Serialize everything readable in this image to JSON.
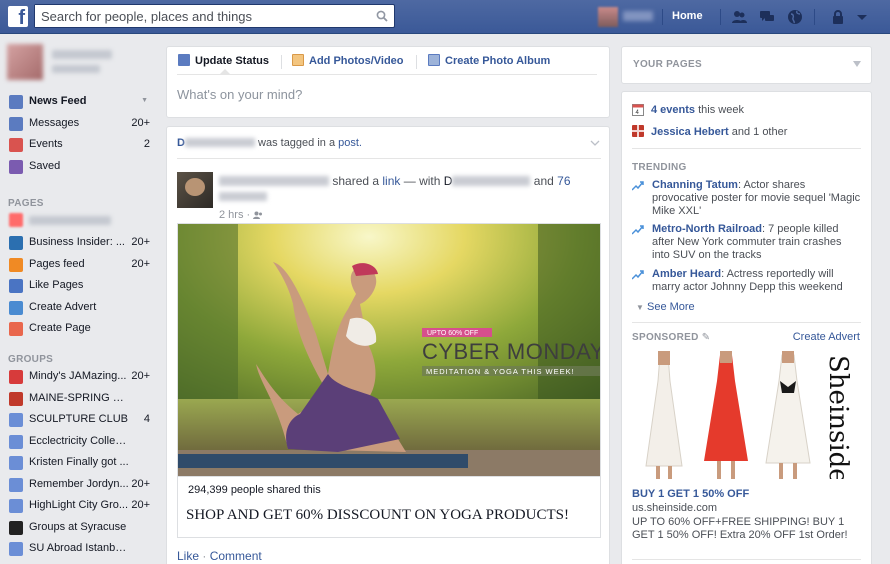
{
  "topbar": {
    "logo": "f",
    "search_placeholder": "Search for people, places and things",
    "home_label": "Home",
    "brand_color": "#3b5998"
  },
  "left_nav": {
    "main": [
      {
        "label": "News Feed",
        "count": "",
        "icon": "news-feed-icon"
      },
      {
        "label": "Messages",
        "count": "20+",
        "icon": "messages-icon"
      },
      {
        "label": "Events",
        "count": "2",
        "icon": "events-icon"
      },
      {
        "label": "Saved",
        "count": "",
        "icon": "saved-icon"
      }
    ],
    "pages_header": "PAGES",
    "pages": [
      {
        "label": "Business Insider: ...",
        "count": "20+",
        "icon": "page-icon"
      },
      {
        "label": "Pages feed",
        "count": "20+",
        "icon": "pages-feed-icon"
      },
      {
        "label": "Like Pages",
        "count": "",
        "icon": "like-pages-icon"
      },
      {
        "label": "Create Advert",
        "count": "",
        "icon": "create-advert-icon"
      },
      {
        "label": "Create Page",
        "count": "",
        "icon": "create-page-icon"
      }
    ],
    "groups_header": "GROUPS",
    "groups": [
      {
        "label": "Mindy's JAMazing...",
        "count": "20+",
        "icon": "gift-icon"
      },
      {
        "label": "MAINE-SPRING B...",
        "count": "",
        "icon": "cup-icon"
      },
      {
        "label": "SCULPTURE CLUB",
        "count": "4",
        "icon": "group-icon"
      },
      {
        "label": "Ecclectricity Colleg...",
        "count": "",
        "icon": "group-icon"
      },
      {
        "label": "Kristen Finally got ...",
        "count": "",
        "icon": "group-icon"
      },
      {
        "label": "Remember Jordyn...",
        "count": "20+",
        "icon": "group-icon"
      },
      {
        "label": "HighLight City Gro...",
        "count": "20+",
        "icon": "group-icon"
      },
      {
        "label": "Groups at Syracuse",
        "count": "",
        "icon": "graduation-cap-icon"
      },
      {
        "label": "SU Abroad Istanbu...",
        "count": "",
        "icon": "group-icon"
      }
    ]
  },
  "composer": {
    "tabs": [
      "Update Status",
      "Add Photos/Video",
      "Create Photo Album"
    ],
    "placeholder": "What's on your mind?"
  },
  "story": {
    "tagged_prefix": "D",
    "tagged_text": "was tagged in a",
    "tagged_link": "post.",
    "shared_text": "shared a",
    "shared_link": "link",
    "with_text": "— with",
    "with_initial": "D",
    "and_text": "and",
    "others_count": "76",
    "time": "2 hrs",
    "ad": {
      "badge": "UPTO 60% OFF",
      "headline": "CYBER MONDAY",
      "subline": "MEDITATION & YOGA THIS WEEK!"
    },
    "shares": "294,399 people shared this",
    "link_title": "SHOP AND GET 60% DISSCOUNT ON YOGA PRODUCTS!",
    "actions": {
      "like": "Like",
      "sep": "·",
      "comment": "Comment"
    }
  },
  "right": {
    "your_pages": "YOUR PAGES",
    "events_link": "4 events",
    "events_suffix": "this week",
    "birthday_link": "Jessica Hebert",
    "birthday_suffix": "and 1 other",
    "trending_header": "TRENDING",
    "trending": [
      {
        "name": "Channing Tatum",
        "text": ": Actor shares provocative poster for movie sequel 'Magic Mike XXL'"
      },
      {
        "name": "Metro-North Railroad",
        "text": ": 7 people killed after New York commuter train crashes into SUV on the tracks"
      },
      {
        "name": "Amber Heard",
        "text": ": Actress reportedly will marry actor Johnny Depp this weekend"
      }
    ],
    "see_more": "See More",
    "sponsored": "SPONSORED",
    "create_advert": "Create Advert",
    "ad_brand": "Sheinside",
    "ad_title": "BUY 1 GET 1 50% OFF",
    "ad_url": "us.sheinside.com",
    "ad_body": "UP TO 60% OFF+FREE SHIPPING! BUY 1 GET 1 50% OFF! Extra 20% OFF 1st Order!"
  }
}
